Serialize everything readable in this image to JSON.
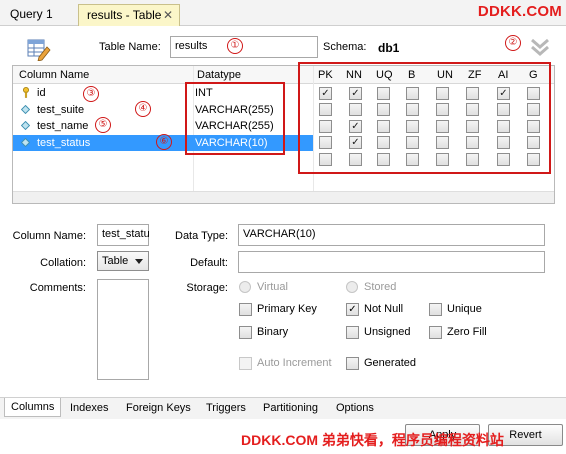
{
  "tabs": {
    "query": "Query 1",
    "table": "results - Table",
    "close": "✕"
  },
  "watermark": {
    "top": "DDKK.COM",
    "bottom": "DDKK.COM 弟弟快看，程序员编程资料站"
  },
  "header": {
    "table_name_label": "Table Name:",
    "table_name_value": "results",
    "schema_label": "Schema:",
    "schema_value": "db1"
  },
  "annotations": [
    "①",
    "②",
    "③",
    "④",
    "⑤",
    "⑥"
  ],
  "grid": {
    "headers": [
      "Column Name",
      "Datatype",
      "PK",
      "NN",
      "UQ",
      "B",
      "UN",
      "ZF",
      "AI",
      "G"
    ],
    "rows": [
      {
        "name": "id",
        "type": "INT",
        "icon": "key-icon",
        "flags": [
          true,
          true,
          false,
          false,
          false,
          false,
          true,
          false
        ],
        "selected": false
      },
      {
        "name": "test_suite",
        "type": "VARCHAR(255)",
        "icon": "diamond-icon",
        "flags": [
          false,
          false,
          false,
          false,
          false,
          false,
          false,
          false
        ],
        "selected": false
      },
      {
        "name": "test_name",
        "type": "VARCHAR(255)",
        "icon": "diamond-icon",
        "flags": [
          false,
          true,
          false,
          false,
          false,
          false,
          false,
          false
        ],
        "selected": false
      },
      {
        "name": "test_status",
        "type": "VARCHAR(10)",
        "icon": "diamond-icon",
        "flags": [
          false,
          true,
          false,
          false,
          false,
          false,
          false,
          false
        ],
        "selected": true
      }
    ],
    "empty_rows": 1
  },
  "details": {
    "column_name_label": "Column Name:",
    "column_name_value": "test_statu",
    "data_type_label": "Data Type:",
    "data_type_value": "VARCHAR(10)",
    "collation_label": "Collation:",
    "collation_value": "Table",
    "default_label": "Default:",
    "default_value": "",
    "comments_label": "Comments:",
    "storage_label": "Storage:",
    "storage_virtual": "Virtual",
    "storage_stored": "Stored",
    "opt_primary_key": "Primary Key",
    "opt_not_null": "Not Null",
    "opt_unique": "Unique",
    "opt_binary": "Binary",
    "opt_unsigned": "Unsigned",
    "opt_zero_fill": "Zero Fill",
    "opt_auto_increment": "Auto Increment",
    "opt_generated": "Generated",
    "not_null_checked": true
  },
  "bottom_tabs": [
    "Columns",
    "Indexes",
    "Foreign Keys",
    "Triggers",
    "Partitioning",
    "Options"
  ],
  "buttons": {
    "apply": "Apply",
    "revert": "Revert"
  },
  "glyphs": {
    "check": "✓"
  },
  "colors": {
    "selection": "#3399ff",
    "annotation": "#d01818",
    "watermark": "#e41e1e"
  }
}
